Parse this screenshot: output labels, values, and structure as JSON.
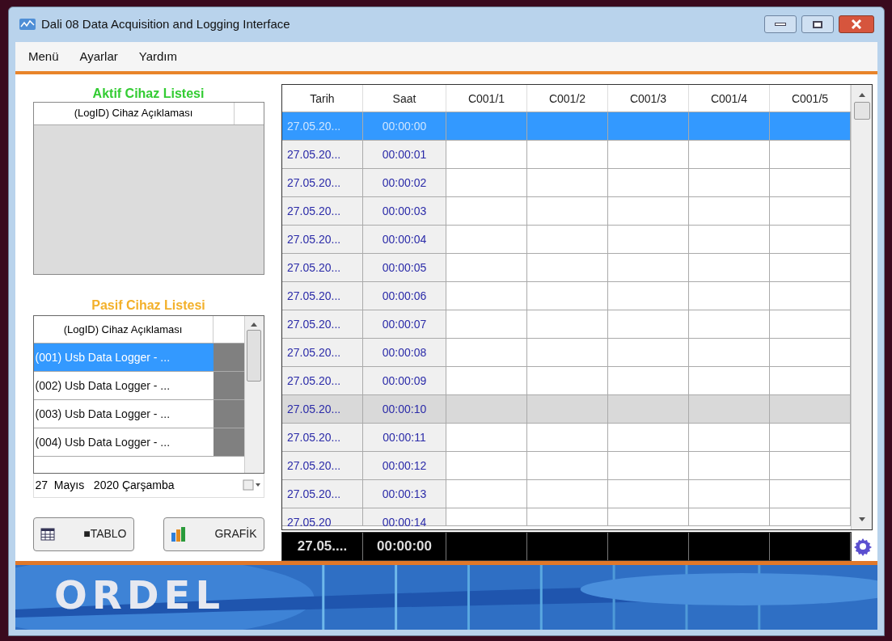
{
  "window": {
    "title": "Dali 08 Data Acquisition and Logging Interface"
  },
  "menu": [
    "Menü",
    "Ayarlar",
    "Yardım"
  ],
  "active_list": {
    "title": "Aktif Cihaz Listesi",
    "column": "(LogID) Cihaz Açıklaması"
  },
  "passive_list": {
    "title": "Pasif Cihaz Listesi",
    "column": "(LogID) Cihaz Açıklaması",
    "rows": [
      {
        "label": "(001) Usb Data Logger - ...",
        "selected": true
      },
      {
        "label": "(002) Usb Data Logger - ...",
        "selected": false
      },
      {
        "label": "(003) Usb Data Logger - ...",
        "selected": false
      },
      {
        "label": "(004) Usb Data Logger - ...",
        "selected": false
      }
    ]
  },
  "date_picker": {
    "value": "27  Mayıs   2020 Çarşamba"
  },
  "buttons": [
    {
      "kind": "table",
      "label": "■TABLO"
    },
    {
      "kind": "chart",
      "label": "GRAFİK"
    }
  ],
  "table": {
    "columns": [
      "Tarih",
      "Saat",
      "C001/1",
      "C001/2",
      "C001/3",
      "C001/4",
      "C001/5"
    ],
    "rows": [
      {
        "date": "27.05.20...",
        "time": "00:00:00",
        "selected": true,
        "highlighted": false
      },
      {
        "date": "27.05.20...",
        "time": "00:00:01",
        "selected": false,
        "highlighted": false
      },
      {
        "date": "27.05.20...",
        "time": "00:00:02",
        "selected": false,
        "highlighted": false
      },
      {
        "date": "27.05.20...",
        "time": "00:00:03",
        "selected": false,
        "highlighted": false
      },
      {
        "date": "27.05.20...",
        "time": "00:00:04",
        "selected": false,
        "highlighted": false
      },
      {
        "date": "27.05.20...",
        "time": "00:00:05",
        "selected": false,
        "highlighted": false
      },
      {
        "date": "27.05.20...",
        "time": "00:00:06",
        "selected": false,
        "highlighted": false
      },
      {
        "date": "27.05.20...",
        "time": "00:00:07",
        "selected": false,
        "highlighted": false
      },
      {
        "date": "27.05.20...",
        "time": "00:00:08",
        "selected": false,
        "highlighted": false
      },
      {
        "date": "27.05.20...",
        "time": "00:00:09",
        "selected": false,
        "highlighted": false
      },
      {
        "date": "27.05.20...",
        "time": "00:00:10",
        "selected": false,
        "highlighted": true
      },
      {
        "date": "27.05.20...",
        "time": "00:00:11",
        "selected": false,
        "highlighted": false
      },
      {
        "date": "27.05.20...",
        "time": "00:00:12",
        "selected": false,
        "highlighted": false
      },
      {
        "date": "27.05.20...",
        "time": "00:00:13",
        "selected": false,
        "highlighted": false
      },
      {
        "date": "27.05.20",
        "time": "00:00:14",
        "selected": false,
        "highlighted": false
      }
    ]
  },
  "footer_row": [
    "27.05....",
    "00:00:00"
  ],
  "banner": {
    "logo": "ORDEL"
  }
}
